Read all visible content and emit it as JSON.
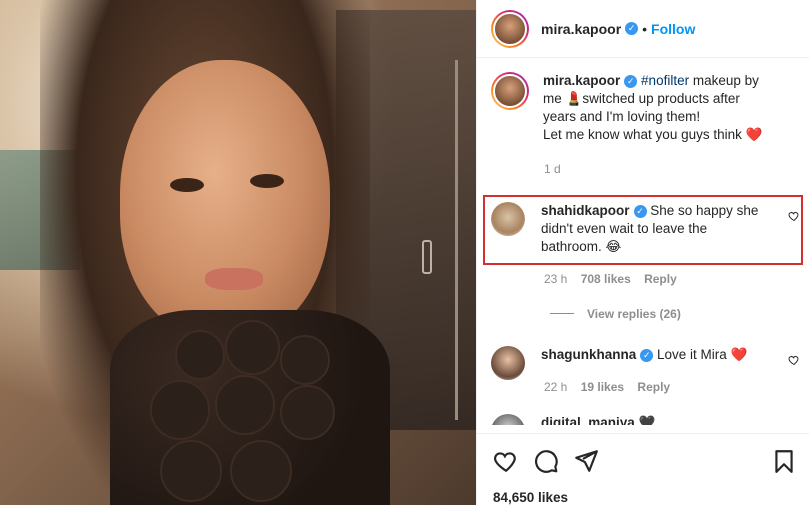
{
  "post": {
    "author": "mira.kapoor",
    "follow_label": "Follow",
    "separator": "•",
    "caption": {
      "hashtag": "#nofilter",
      "line1_rest": " makeup by",
      "line2": "me 💄switched up products after",
      "line3": "years and I'm loving them!",
      "line4": "Let me know what you guys think ❤️"
    },
    "caption_time": "1 d",
    "likes_count": "84,650 likes"
  },
  "comments": [
    {
      "username": "shahidkapoor",
      "text_line1": " She so happy she",
      "text_line2": "didn't even wait to leave the",
      "text_line3": "bathroom. 😂",
      "time": "23 h",
      "likes": "708 likes",
      "reply_label": "Reply",
      "view_replies": "View replies (26)"
    },
    {
      "username": "shagunkhanna",
      "text": " Love it Mira ❤️",
      "time": "22 h",
      "likes": "19 likes",
      "reply_label": "Reply"
    },
    {
      "username": "digital_maniya",
      "text": " 🖤"
    }
  ],
  "colors": {
    "accent_blue": "#0095f6",
    "verified_blue": "#3897f0",
    "highlight_red": "#d32f2f",
    "heart_red": "#ed4956"
  },
  "icons": [
    "heart-icon",
    "comment-icon",
    "share-icon",
    "bookmark-icon",
    "verified-badge-icon"
  ]
}
